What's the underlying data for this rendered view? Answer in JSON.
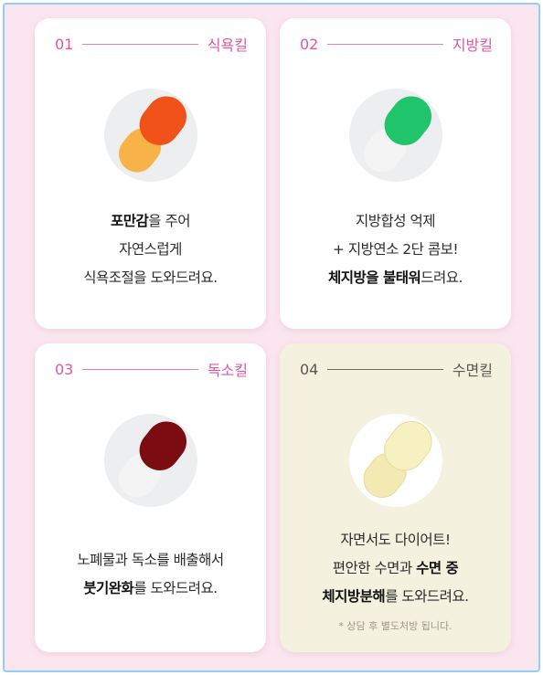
{
  "cards": [
    {
      "num": "01",
      "tag": "식욕킬",
      "lines": [
        {
          "bold": "포만감",
          "rest": "을 주어"
        },
        {
          "bold": "",
          "rest": "자연스럽게"
        },
        {
          "bold": "",
          "rest": "식욕조절을 도와드려요."
        }
      ],
      "pill_colors": {
        "top": "#f0521a",
        "bottom": "#f7b347"
      }
    },
    {
      "num": "02",
      "tag": "지방킬",
      "lines": [
        {
          "bold": "",
          "rest": "지방합성 억제"
        },
        {
          "bold": "",
          "rest": "+ 지방연소 2단 콤보!"
        },
        {
          "bold": "체지방을 불태워",
          "rest": "드려요."
        }
      ],
      "pill_colors": {
        "top": "#1fc46b",
        "bottom": "#f4f4f4"
      }
    },
    {
      "num": "03",
      "tag": "독소킬",
      "lines": [
        {
          "bold": "",
          "rest": "노폐물과 독소를 배출해서"
        },
        {
          "bold": "붓기완화",
          "rest": "를 도와드려요."
        }
      ],
      "pill_colors": {
        "top": "#7a0c12",
        "bottom": "#f4f4f4"
      }
    },
    {
      "num": "04",
      "tag": "수면킬",
      "lines": [
        {
          "bold": "",
          "rest": "자면서도 다이어트!"
        },
        {
          "pre": "편안한 수면과 ",
          "bold": "수면 중",
          "rest": ""
        },
        {
          "bold": "체지방분해",
          "rest": "를 도와드려요."
        }
      ],
      "note": "* 상담 후 별도처방 됩니다.",
      "pill_colors": {
        "top": "#f7f0c0",
        "bottom": "#f3eab3"
      }
    }
  ]
}
